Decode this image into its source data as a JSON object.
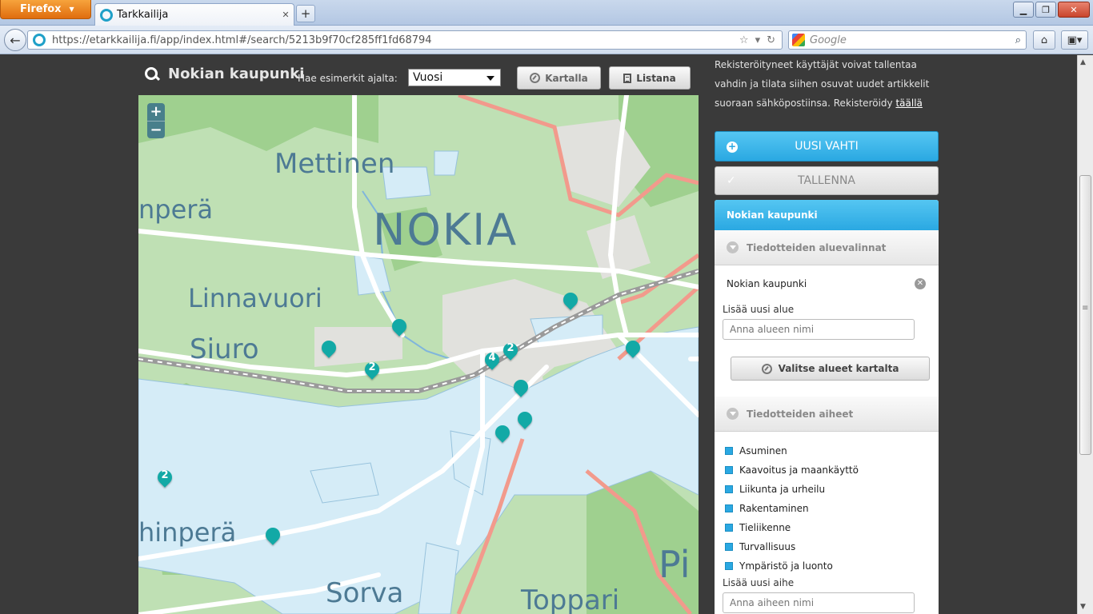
{
  "browser": {
    "menu_label": "Firefox",
    "tab_title": "Tarkkailija",
    "url": "https://etarkkailija.fi/app/index.html#/search/5213b9f70cf285ff1fd68794",
    "search_placeholder": "Google"
  },
  "header": {
    "place_name": "Nokian kaupunki",
    "example_label": "Hae esimerkit ajalta:",
    "period_selected": "Vuosi",
    "map_button": "Kartalla",
    "list_button": "Listana"
  },
  "map": {
    "labels": [
      "Mettinen",
      "NOKIA",
      "Linnavuori",
      "Siuro",
      "nperä",
      "hinperä",
      "Sorva",
      "Toppari",
      "Pi"
    ],
    "clusters": [
      "2",
      "4",
      "2",
      "2"
    ],
    "zoom_in": "+",
    "zoom_out": "−"
  },
  "sidebar": {
    "intro": "Rekisteröityneet käyttäjät voivat tallentaa vahdin ja tilata siihen osuvat uudet artikkelit suoraan sähköpostiinsa. Rekisteröidy",
    "intro_link": "täällä",
    "new_watch": "UUSI VAHTI",
    "save": "TALLENNA",
    "watch_title": "Nokian kaupunki",
    "areas_header": "Tiedotteiden aluevalinnat",
    "selected_area": "Nokian kaupunki",
    "add_area_label": "Lisää uusi alue",
    "add_area_placeholder": "Anna alueen nimi",
    "pick_on_map": "Valitse alueet kartalta",
    "topics_header": "Tiedotteiden aiheet",
    "topics": [
      "Asuminen",
      "Kaavoitus ja maankäyttö",
      "Liikunta ja urheilu",
      "Rakentaminen",
      "Tieliikenne",
      "Turvallisuus",
      "Ympäristö ja luonto"
    ],
    "add_topic_label": "Lisää uusi aihe",
    "add_topic_placeholder": "Anna aiheen nimi"
  }
}
